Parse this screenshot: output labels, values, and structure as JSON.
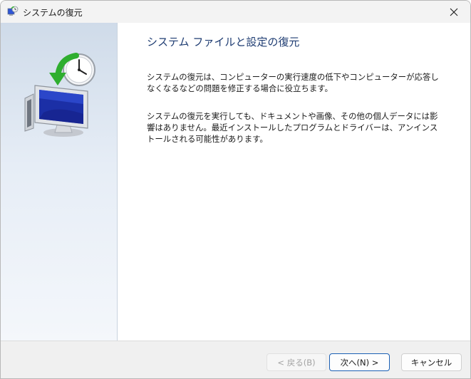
{
  "window": {
    "title": "システムの復元",
    "close_glyph": "✕"
  },
  "content": {
    "heading": "システム ファイルと設定の復元",
    "paragraph1": "システムの復元は、コンピューターの実行速度の低下やコンピューターが応答しなくなるなどの問題を修正する場合に役立ちます。",
    "paragraph2": "システムの復元を実行しても、ドキュメントや画像、その他の個人データには影響はありません。最近インストールしたプログラムとドライバーは、アンインストールされる可能性があります。"
  },
  "footer": {
    "back_label": "< 戻る(B)",
    "next_label": "次へ(N) >",
    "cancel_label": "キャンセル"
  },
  "icons": {
    "app": "system-restore-icon",
    "hero": "system-restore-computer-icon",
    "close": "close-icon"
  },
  "colors": {
    "heading": "#1e3c72",
    "accent": "#1a5fb4",
    "titlebar": "#f3f3f3",
    "footer": "#f0f0f0"
  }
}
